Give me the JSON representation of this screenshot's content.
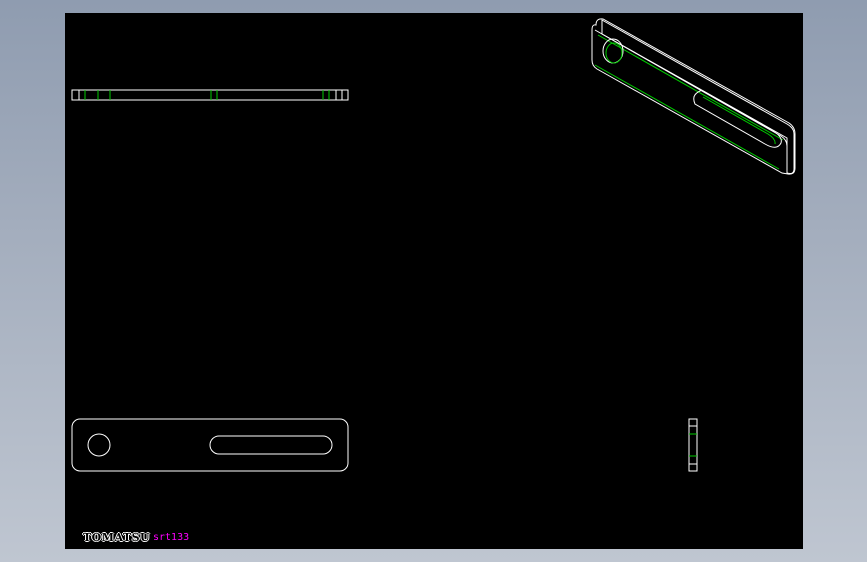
{
  "drawing": {
    "background_color": "#000000",
    "outline_color": "#ffffff",
    "edge_color": "#00cc00",
    "views": [
      "top-view",
      "isometric-view",
      "front-view",
      "side-view"
    ]
  },
  "title_block": {
    "logo_text": "TOMATSU",
    "part_code": "srt133",
    "part_code_color": "#ff00ff"
  }
}
